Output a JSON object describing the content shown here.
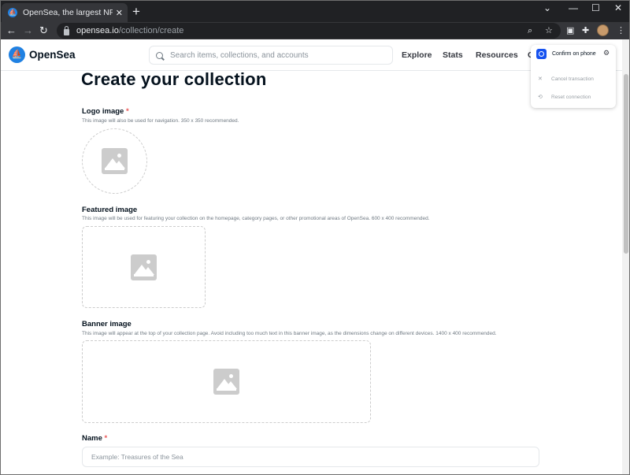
{
  "browser": {
    "tab_title": "OpenSea, the largest NFT marketplace",
    "tab_favicon_icon": "opensea-logo-icon",
    "url_host": "opensea.io",
    "url_path": "/collection/create"
  },
  "header": {
    "logo_text": "OpenSea",
    "search_placeholder": "Search items, collections, and accounts",
    "nav": {
      "explore": "Explore",
      "stats": "Stats",
      "resources": "Resources",
      "create": "C"
    }
  },
  "wallet_popup": {
    "confirm_text": "Confirm on phone",
    "items": [
      {
        "label": "Cancel transaction",
        "icon": "close-icon"
      },
      {
        "label": "Reset connection",
        "icon": "refresh-icon"
      }
    ]
  },
  "form": {
    "title": "Create your collection",
    "required_mark": "*",
    "logo": {
      "label": "Logo image",
      "description": "This image will also be used for navigation. 350 x 350 recommended."
    },
    "featured": {
      "label": "Featured image",
      "description": "This image will be used for featuring your collection on the homepage, category pages, or other promotional areas of OpenSea. 600 x 400 recommended."
    },
    "banner": {
      "label": "Banner image",
      "description": "This image will appear at the top of your collection page. Avoid including too much text in this banner image, as the dimensions change on different devices. 1400 x 400 recommended."
    },
    "name": {
      "label": "Name",
      "value": "",
      "placeholder": "Example: Treasures of the Sea"
    }
  },
  "colors": {
    "brand": "#2081e2",
    "required": "#eb5757",
    "wallet_icon": "#1652f0"
  }
}
